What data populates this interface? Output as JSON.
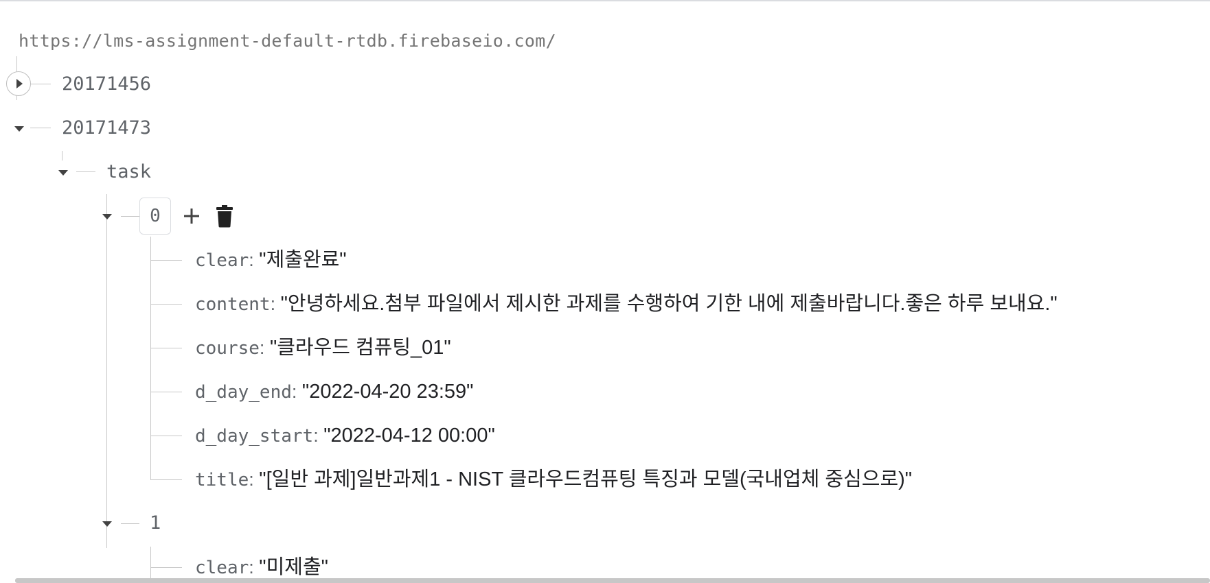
{
  "database_url": "https://lms-assignment-default-rtdb.firebaseio.com/",
  "tree": {
    "root_nodes": [
      {
        "key": "20171456",
        "state": "collapsed"
      },
      {
        "key": "20171473",
        "state": "expanded"
      }
    ],
    "task_node": {
      "key": "task"
    },
    "items": [
      {
        "key": "0",
        "fields": [
          {
            "key": "clear",
            "value": "\"제출완료\""
          },
          {
            "key": "content",
            "value": "\"안녕하세요.첨부 파일에서 제시한 과제를 수행하여 기한 내에 제출바랍니다.좋은 하루 보내요.\""
          },
          {
            "key": "course",
            "value": "\"클라우드 컴퓨팅_01\""
          },
          {
            "key": "d_day_end",
            "value": "\"2022-04-20 23:59\""
          },
          {
            "key": "d_day_start",
            "value": "\"2022-04-12 00:00\""
          },
          {
            "key": "title",
            "value": "\"[일반 과제]일반과제1 - NIST 클라우드컴퓨팅 특징과 모델(국내업체 중심으로)\""
          }
        ]
      },
      {
        "key": "1",
        "fields": [
          {
            "key": "clear",
            "value": "\"미제출\""
          }
        ]
      }
    ]
  },
  "icons": {
    "add": "plus-icon",
    "delete": "trash-icon",
    "expand": "expand-arrow-icon",
    "collapse": "collapse-caret-icon"
  }
}
